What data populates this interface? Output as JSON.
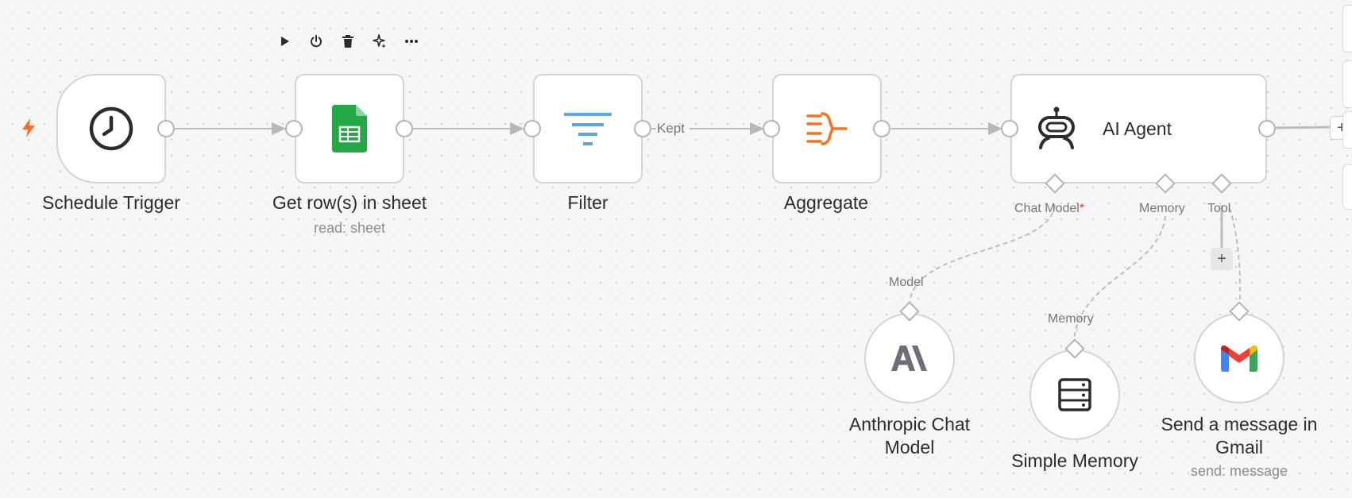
{
  "toolbar": {
    "icons": [
      "play-icon",
      "power-icon",
      "trash-icon",
      "sparkle-icon",
      "more-icon"
    ]
  },
  "nodes": {
    "schedule": {
      "label": "Schedule Trigger"
    },
    "sheets": {
      "label": "Get row(s) in sheet",
      "sublabel": "read: sheet"
    },
    "filter": {
      "label": "Filter",
      "output_label": "Kept"
    },
    "aggregate": {
      "label": "Aggregate"
    },
    "agent": {
      "label": "AI Agent",
      "chat_model_label": "Chat Model",
      "chat_model_required": "*",
      "memory_label": "Memory",
      "tool_label": "Tool"
    },
    "anthropic": {
      "label_line1": "Anthropic Chat",
      "label_line2": "Model",
      "input_label": "Model"
    },
    "memory": {
      "label": "Simple Memory",
      "input_label": "Memory"
    },
    "gmail": {
      "label_line1": "Send a message in",
      "label_line2": "Gmail",
      "sublabel": "send: message"
    }
  },
  "buttons": {
    "add_tool": "+",
    "add_next": "+"
  },
  "colors": {
    "trigger_bolt": "#ff6d2d",
    "sheets_green": "#22a845",
    "filter_blue": "#5aa6e8",
    "aggregate_orange": "#f5731c",
    "required_red": "#e0383e"
  }
}
